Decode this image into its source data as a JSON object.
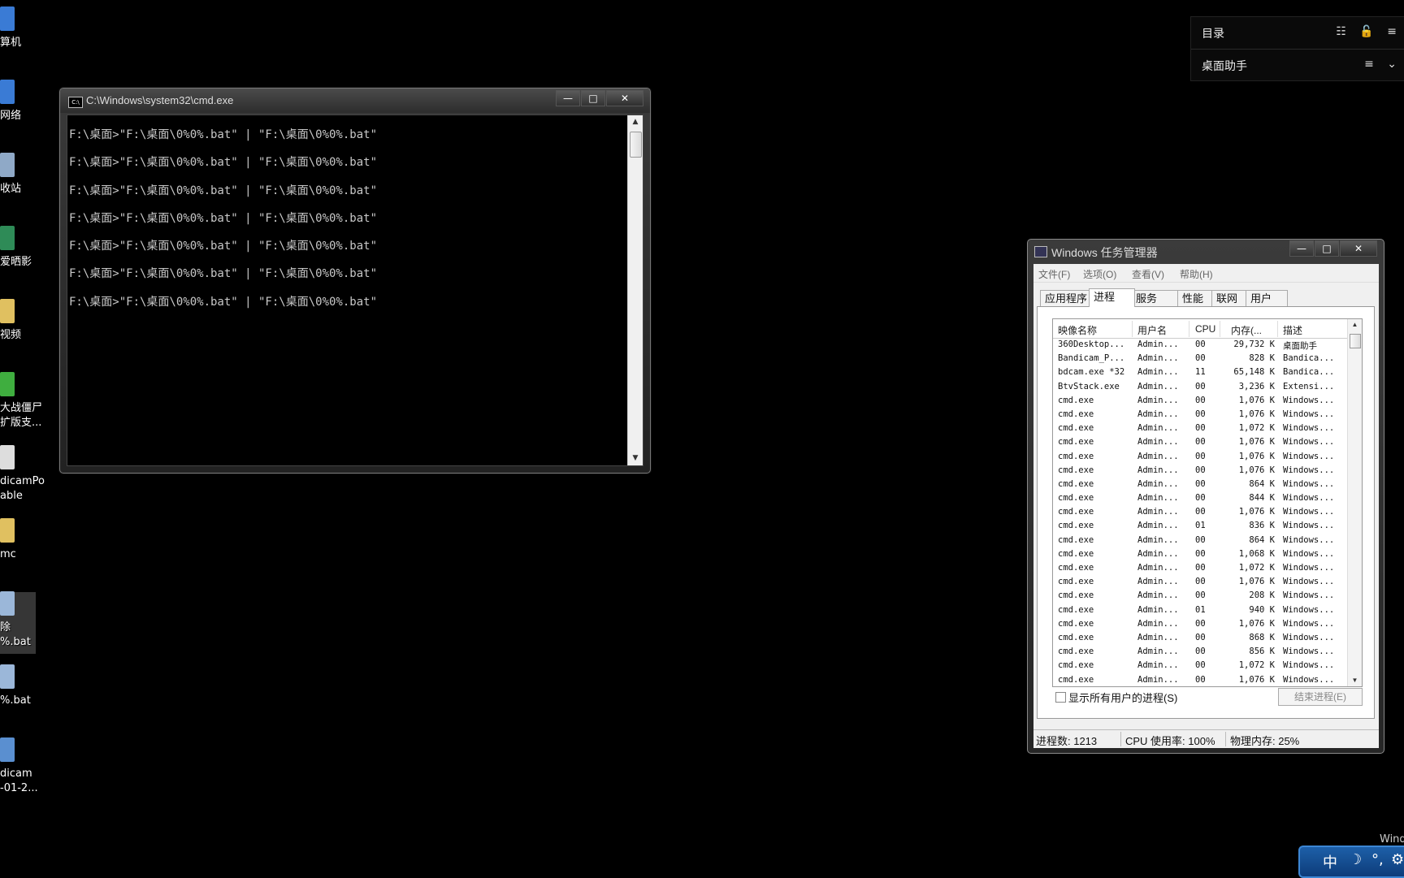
{
  "desktop": {
    "icons": [
      {
        "label": "算机",
        "icon": "computer-icon"
      },
      {
        "label": "网络",
        "icon": "network-icon"
      },
      {
        "label": "收站",
        "icon": "recycle-bin-icon"
      },
      {
        "label": "爱晒影",
        "icon": "app-icon"
      },
      {
        "label": "视频",
        "icon": "folder-icon"
      },
      {
        "label": "大战僵尸",
        "label2": "扩版支...",
        "icon": "game-icon"
      },
      {
        "label": "dicamPo",
        "label2": "able",
        "icon": "file-icon"
      },
      {
        "label": "mc",
        "icon": "folder-icon"
      },
      {
        "label": "除",
        "label2": "%.bat",
        "icon": "bat-icon"
      },
      {
        "label": "%.bat",
        "icon": "bat-icon"
      },
      {
        "label": "dicam",
        "label2": "-01-2...",
        "icon": "video-icon"
      }
    ]
  },
  "cmd": {
    "title": "C:\\Windows\\system32\\cmd.exe",
    "line": "F:\\桌面>\"F:\\桌面\\0%0%.bat\" | \"F:\\桌面\\0%0%.bat\"",
    "buttons": {
      "minimize": "—",
      "maximize": "□",
      "close": "✕"
    }
  },
  "side_panel": {
    "row1_label": "目录",
    "row1_icons": "☷ 🔓 ≡",
    "row2_label": "桌面助手",
    "row2_icons": "≡ ⌄"
  },
  "task_manager": {
    "title": "Windows 任务管理器",
    "buttons": {
      "minimize": "—",
      "maximize": "□",
      "close": "✕"
    },
    "menu": [
      "文件(F)",
      "选项(O)",
      "查看(V)",
      "帮助(H)"
    ],
    "tabs": [
      "应用程序",
      "进程",
      "服务",
      "性能",
      "联网",
      "用户"
    ],
    "active_tab": "进程",
    "columns": [
      "映像名称",
      "用户名",
      "CPU",
      "内存(...",
      "描述"
    ],
    "rows": [
      [
        "360Desktop...",
        "Admin...",
        "00",
        "29,732 K",
        "桌面助手"
      ],
      [
        "Bandicam_P...",
        "Admin...",
        "00",
        "828 K",
        "Bandica..."
      ],
      [
        "bdcam.exe *32",
        "Admin...",
        "11",
        "65,148 K",
        "Bandica..."
      ],
      [
        "BtvStack.exe",
        "Admin...",
        "00",
        "3,236 K",
        "Extensi..."
      ],
      [
        "cmd.exe",
        "Admin...",
        "00",
        "1,076 K",
        "Windows..."
      ],
      [
        "cmd.exe",
        "Admin...",
        "00",
        "1,076 K",
        "Windows..."
      ],
      [
        "cmd.exe",
        "Admin...",
        "00",
        "1,072 K",
        "Windows..."
      ],
      [
        "cmd.exe",
        "Admin...",
        "00",
        "1,076 K",
        "Windows..."
      ],
      [
        "cmd.exe",
        "Admin...",
        "00",
        "1,076 K",
        "Windows..."
      ],
      [
        "cmd.exe",
        "Admin...",
        "00",
        "1,076 K",
        "Windows..."
      ],
      [
        "cmd.exe",
        "Admin...",
        "00",
        "864 K",
        "Windows..."
      ],
      [
        "cmd.exe",
        "Admin...",
        "00",
        "844 K",
        "Windows..."
      ],
      [
        "cmd.exe",
        "Admin...",
        "00",
        "1,076 K",
        "Windows..."
      ],
      [
        "cmd.exe",
        "Admin...",
        "01",
        "836 K",
        "Windows..."
      ],
      [
        "cmd.exe",
        "Admin...",
        "00",
        "864 K",
        "Windows..."
      ],
      [
        "cmd.exe",
        "Admin...",
        "00",
        "1,068 K",
        "Windows..."
      ],
      [
        "cmd.exe",
        "Admin...",
        "00",
        "1,072 K",
        "Windows..."
      ],
      [
        "cmd.exe",
        "Admin...",
        "00",
        "1,076 K",
        "Windows..."
      ],
      [
        "cmd.exe",
        "Admin...",
        "00",
        "208 K",
        "Windows..."
      ],
      [
        "cmd.exe",
        "Admin...",
        "01",
        "940 K",
        "Windows..."
      ],
      [
        "cmd.exe",
        "Admin...",
        "00",
        "1,076 K",
        "Windows..."
      ],
      [
        "cmd.exe",
        "Admin...",
        "00",
        "868 K",
        "Windows..."
      ],
      [
        "cmd.exe",
        "Admin...",
        "00",
        "856 K",
        "Windows..."
      ],
      [
        "cmd.exe",
        "Admin...",
        "00",
        "1,072 K",
        "Windows..."
      ],
      [
        "cmd.exe",
        "Admin...",
        "00",
        "1,076 K",
        "Windows..."
      ]
    ],
    "show_all_label": "显示所有用户的进程(S)",
    "end_process_label": "结束进程(E)",
    "status": {
      "processes": "进程数: 1213",
      "cpu": "CPU 使用率: 100%",
      "memory": "物理内存: 25%"
    }
  },
  "langbar": {
    "lang": "中",
    "moon": "☽",
    "dots": "°,",
    "extra": "⚙"
  },
  "corner_text": "Wind"
}
